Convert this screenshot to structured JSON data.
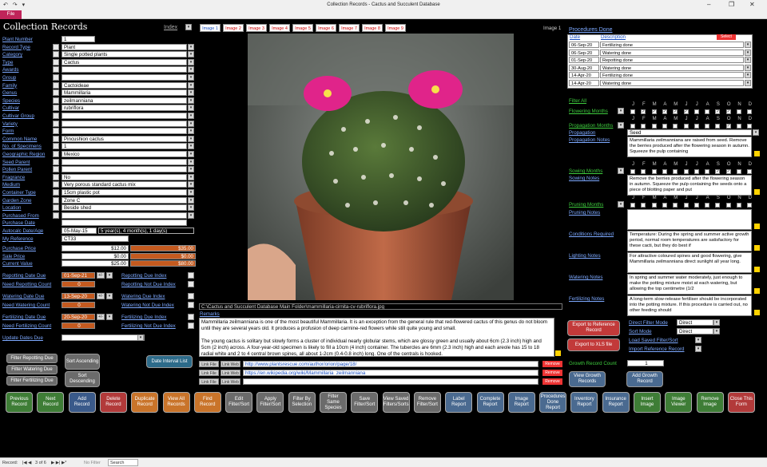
{
  "window": {
    "title": "Collection Records  -  Cactus and Succulent Database",
    "file_tab": "File"
  },
  "form": {
    "title": "Collection Records",
    "index_label": "Index",
    "image_label": "Image 1"
  },
  "fields": [
    {
      "label": "Plant Number",
      "value": "1",
      "check": false
    },
    {
      "label": "Record Type",
      "value": "Plant",
      "check": true
    },
    {
      "label": "Category",
      "value": "Single potted plants",
      "check": true
    },
    {
      "label": "Type",
      "value": "Cactus",
      "check": true
    },
    {
      "label": "Awards",
      "value": "",
      "check": true
    },
    {
      "label": "Group",
      "value": "",
      "check": true
    },
    {
      "label": "Family",
      "value": "Cactoideae",
      "check": true
    },
    {
      "label": "Genus",
      "value": "Mammillaria",
      "check": true
    },
    {
      "label": "Species",
      "value": "zeilmanniana",
      "check": true
    },
    {
      "label": "Cultivar",
      "value": "rubriflora",
      "check": true
    },
    {
      "label": "Cultivar Group",
      "value": "",
      "check": true
    },
    {
      "label": "Variety",
      "value": "",
      "check": true
    },
    {
      "label": "Form",
      "value": "",
      "check": true
    },
    {
      "label": "Common Name",
      "value": "Pincushion cactus",
      "check": true
    },
    {
      "label": "No. of Specimens",
      "value": "1",
      "check": true
    },
    {
      "label": "Geographic Region",
      "value": "Mexico",
      "check": true
    },
    {
      "label": "Seed Parent",
      "value": "",
      "check": true
    },
    {
      "label": "Pollen Parent",
      "value": "",
      "check": true
    },
    {
      "label": "Fragrance",
      "value": "No",
      "check": true
    },
    {
      "label": "Medium",
      "value": "Very porous standard cactus mix",
      "check": true
    },
    {
      "label": "Container Type",
      "value": "15cm plastic pot",
      "check": true
    },
    {
      "label": "Garden Zone",
      "value": "Zone C",
      "check": true
    },
    {
      "label": "Location",
      "value": "Beside shed",
      "check": true
    },
    {
      "label": "Purchased From",
      "value": "",
      "check": true
    },
    {
      "label": "Purchase Date",
      "value": "",
      "check": false
    }
  ],
  "autocalc": {
    "label": "Autocalc Date/Age",
    "date": "05-May-15",
    "age": "5 year(s), 4 month(s), 1 day(s)"
  },
  "my_reference": {
    "label": "My Reference",
    "value": "CT33"
  },
  "prices": [
    {
      "label": "Purchase Price",
      "value": "$12.00",
      "currency": "$35.00"
    },
    {
      "label": "Sale Price",
      "value": "$0.00",
      "currency": "$0.00"
    },
    {
      "label": "Current Value",
      "value": "$25.00",
      "currency": "$80.00"
    }
  ],
  "dues": [
    {
      "label": "Repotting Date Due",
      "value": "01-Sep-21",
      "count_label": "Need Repotting Count",
      "count": "0",
      "idx1": "Repotting Due Index",
      "idx2": "Repotting Not Due Index"
    },
    {
      "label": "Watering Date Due",
      "value": "13-Sep-20",
      "count_label": "Need Watering Count",
      "count": "0",
      "idx1": "Watering Due Index",
      "idx2": "Watering Not Due Index"
    },
    {
      "label": "Fertilizing Date Due",
      "value": "20-Sep-20",
      "count_label": "Need Fertilizing Count",
      "count": "0",
      "idx1": "Fertilizing Due Index",
      "idx2": "Fertilizing Not Due Index"
    }
  ],
  "update_dates": "Update Dates Due",
  "image_tabs": [
    "Image 1",
    "Image 2",
    "Image 3",
    "Image 4",
    "Image 5",
    "Image 6",
    "Image 7",
    "Image 8",
    "Image 9"
  ],
  "image_path": "C:\\Cactus and Succulent Database Main Folder\\mammillaria-cirnita-cv-rubriflora.jpg",
  "remarks": {
    "label": "Remarks",
    "text1": "Mammillaria zeilmanniana is one of the most beautiful Mammillaria. It is an exception from the general rule that red-flowered cactus of this genus do not bloom until they are several years old. It produces a profusion of deep carmine-red flowers while still quite young  and small.",
    "text2": "The young cactus is solitary but slowly forms a cluster of individual nearly globular stems, which are glossy green and usually  about 6cm (2.3 inch) high and 5cm (2 inch) across. A four-year-old specimen is likely to fill a 10cm (4 inch) container. The tubercles are 6mm (2.3 inch) high and each areole has 15 to 18 radial white and 2 to 4 central brown spines, all about 1-2cm (0.4-0.8 inch) long. One of the centrals is hooked."
  },
  "links": [
    {
      "url": "http://www.plantsrescue.com/author/orion/page/18/",
      "link_file": "Link File",
      "link_web": "Link Web",
      "remove": "Remove"
    },
    {
      "url": "https://en.wikipedia.org/wiki/Mammillaria_zeilmanniana",
      "link_file": "Link File",
      "link_web": "Link Web",
      "remove": "Remove"
    },
    {
      "url": "",
      "link_file": "Link File",
      "link_web": "Link Web",
      "remove": "Remove"
    }
  ],
  "procedures": {
    "title": "Procedures Done",
    "col_date": "Date",
    "col_desc": "Description",
    "select": "Select",
    "rows": [
      {
        "date": "06-Sep-20",
        "desc": "Fertilizing done"
      },
      {
        "date": "06-Sep-20",
        "desc": "Watering done"
      },
      {
        "date": "01-Sep-20",
        "desc": "Repotting done"
      },
      {
        "date": "30-Aug-20",
        "desc": "Watering done"
      },
      {
        "date": "14-Apr-20",
        "desc": "Fertilizing done"
      },
      {
        "date": "14-Apr-20",
        "desc": "Watering done"
      }
    ]
  },
  "months": [
    "J",
    "F",
    "M",
    "A",
    "M",
    "J",
    "J",
    "A",
    "S",
    "O",
    "N",
    "D"
  ],
  "filter_all": "Filter All",
  "month_rows": [
    {
      "label": "Flowering Months",
      "checks": [
        false,
        true,
        true,
        true,
        true,
        true,
        false,
        false,
        true,
        true,
        false,
        false
      ]
    },
    {
      "label": "Propagation Months",
      "checks": [
        false,
        false,
        false,
        false,
        false,
        false,
        false,
        false,
        false,
        true,
        false,
        false
      ]
    },
    {
      "label": "Sowing Months",
      "checks": [
        false,
        false,
        false,
        false,
        false,
        false,
        false,
        false,
        true,
        true,
        false,
        false
      ]
    },
    {
      "label": "Pruning Months",
      "checks": [
        false,
        false,
        false,
        false,
        false,
        false,
        false,
        false,
        false,
        false,
        false,
        false
      ]
    }
  ],
  "propagation": {
    "label": "Propagation",
    "value": "Seed"
  },
  "notes": [
    {
      "label": "Propagation Notes",
      "text": "Mammillaria zeilmanniana are raised from seed. Remove the berries produced after the flowering season in autumn. Squeeze the pulp containing"
    },
    {
      "label": "Sowing Notes",
      "text": "Remove the berries produced after the flowering season in autumn. Squeeze the pulp containing the seeds onto a piece of blotting paper and put"
    },
    {
      "label": "Pruning Notes",
      "text": ""
    },
    {
      "label": "Conditions Required",
      "text": "Temperature: During the spring and summer active growth period, normal room temperatures are satisfactory for these cacti, but they do best if"
    },
    {
      "label": "Lighting Notes",
      "text": "For attractive coloured spines and good flowering, give Mammillaria zeilmanniana direct sunlight all year long."
    },
    {
      "label": "Watering Notes",
      "text": "In spring and summer water moderately, just enough to make the potting mixture moist at each watering, but allowing the top centimetre (1/2"
    },
    {
      "label": "Fertilizing Notes",
      "text": "A long-term slow-release fertiliser should be incorporated into the potting mixture. If this procedure is carried out, no other feeding should"
    }
  ],
  "right_controls": {
    "export_ref": "Export to Reference Record",
    "export_xls": "Export to XLS file",
    "direct_filter_mode": "Direct Filter Mode",
    "direct_filter_value": "Direct",
    "sort_mode": "Sort Mode",
    "sort_value": "Direct",
    "load_saved": "Load Saved Filter/Sort",
    "import_ref": "Import Reference Record",
    "growth_count_label": "Growth Record Count",
    "growth_count": "1",
    "view_growth": "View Growth Records",
    "add_growth": "Add Growth Record"
  },
  "small_buttons": {
    "filter_repot": "Filter Repotting Due",
    "filter_water": "Filter Watering Due",
    "filter_fert": "Filter Fertilizing Due",
    "sort_asc": "Sort Ascending",
    "sort_desc": "Sort Descending",
    "date_interval": "Date Interval List"
  },
  "bottom_buttons": [
    {
      "label": "Previous Record",
      "color": "#3e7d36"
    },
    {
      "label": "Next Record",
      "color": "#3e7d36"
    },
    {
      "label": "Add Record",
      "color": "#3a5a8a"
    },
    {
      "label": "Delete Record",
      "color": "#b23a3a"
    },
    {
      "label": "Duplicate Record",
      "color": "#c9742a"
    },
    {
      "label": "View All Records",
      "color": "#c9742a"
    },
    {
      "label": "Find Record",
      "color": "#c9742a"
    },
    {
      "label": "Edit Filter/Sort",
      "color": "#6b6b6b"
    },
    {
      "label": "Apply Filter/Sort",
      "color": "#6b6b6b"
    },
    {
      "label": "Filter By Selection",
      "color": "#6b6b6b"
    },
    {
      "label": "Filter Same Species",
      "color": "#6b6b6b"
    },
    {
      "label": "Save Filter/Sort",
      "color": "#6b6b6b"
    },
    {
      "label": "View Saved Filters/Sorts",
      "color": "#6b6b6b"
    },
    {
      "label": "Remove Filter/Sort",
      "color": "#6b6b6b"
    },
    {
      "label": "Label Report",
      "color": "#4a6a90"
    },
    {
      "label": "Complete Report",
      "color": "#4a6a90"
    },
    {
      "label": "Image Report",
      "color": "#4a6a90"
    },
    {
      "label": "Procedures Done Report",
      "color": "#4a6a90"
    },
    {
      "label": "Inventory Report",
      "color": "#4a6a90"
    },
    {
      "label": "Insurance Report",
      "color": "#4a6a90"
    },
    {
      "label": "Insert Image",
      "color": "#3e7d36"
    },
    {
      "label": "Image Viewer",
      "color": "#3e7d36"
    },
    {
      "label": "Remove Image",
      "color": "#3e7d36"
    },
    {
      "label": "Close This Form",
      "color": "#b23a3a"
    }
  ],
  "status": {
    "record_label": "Record:",
    "position": "3 of 6",
    "filter": "No Filter",
    "search": "Search"
  }
}
